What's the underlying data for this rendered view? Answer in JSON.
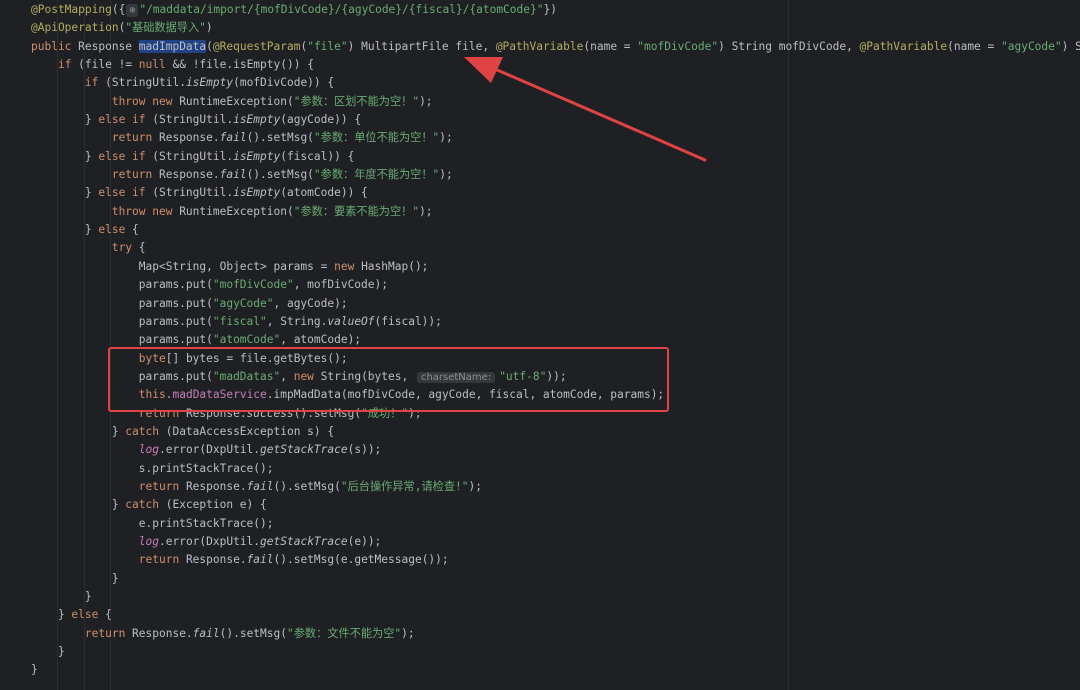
{
  "editor": {
    "language": "Java",
    "annotation_colors": {
      "highlight_box": "#e04343",
      "arrow": "#e04343",
      "selection": "#214283"
    },
    "lines": [
      [
        [
          "ann",
          "@PostMapping"
        ],
        [
          "plain",
          "({"
        ],
        [
          "fold",
          "⊕"
        ],
        [
          "str",
          "\"/maddata/import/{mofDivCode}/{agyCode}/{fiscal}/{atomCode}\""
        ],
        [
          "plain",
          "})"
        ]
      ],
      [
        [
          "ann",
          "@ApiOperation"
        ],
        [
          "plain",
          "("
        ],
        [
          "str",
          "\"基础数据导入\""
        ],
        [
          "plain",
          ")"
        ]
      ],
      [
        [
          "kw",
          "public "
        ],
        [
          "plain",
          "Response "
        ],
        [
          "sel",
          "madImpData"
        ],
        [
          "plain",
          "("
        ],
        [
          "ann",
          "@RequestParam"
        ],
        [
          "plain",
          "("
        ],
        [
          "str",
          "\"file\""
        ],
        [
          "plain",
          ") MultipartFile file, "
        ],
        [
          "ann",
          "@PathVariable"
        ],
        [
          "plain",
          "(name = "
        ],
        [
          "str",
          "\"mofDivCode\""
        ],
        [
          "plain",
          ") String mofDivCode, "
        ],
        [
          "ann",
          "@PathVariable"
        ],
        [
          "plain",
          "(name = "
        ],
        [
          "str",
          "\"agyCode\""
        ],
        [
          "plain",
          ") String"
        ]
      ],
      [
        [
          "plain",
          "    "
        ],
        [
          "kw",
          "if "
        ],
        [
          "plain",
          "(file != "
        ],
        [
          "kw",
          "null "
        ],
        [
          "plain",
          "&& !file.isEmpty()) {"
        ]
      ],
      [
        [
          "plain",
          "        "
        ],
        [
          "kw",
          "if "
        ],
        [
          "plain",
          "(StringUtil."
        ],
        [
          "static",
          "isEmpty"
        ],
        [
          "plain",
          "(mofDivCode)) {"
        ]
      ],
      [
        [
          "plain",
          "            "
        ],
        [
          "kw",
          "throw new "
        ],
        [
          "plain",
          "RuntimeException("
        ],
        [
          "str",
          "\"参数：区划不能为空！\""
        ],
        [
          "plain",
          ");"
        ]
      ],
      [
        [
          "plain",
          "        } "
        ],
        [
          "kw",
          "else if "
        ],
        [
          "plain",
          "(StringUtil."
        ],
        [
          "static",
          "isEmpty"
        ],
        [
          "plain",
          "(agyCode)) {"
        ]
      ],
      [
        [
          "plain",
          "            "
        ],
        [
          "kw",
          "return "
        ],
        [
          "plain",
          "Response."
        ],
        [
          "static",
          "fail"
        ],
        [
          "plain",
          "().setMsg("
        ],
        [
          "str",
          "\"参数：单位不能为空！\""
        ],
        [
          "plain",
          ");"
        ]
      ],
      [
        [
          "plain",
          "        } "
        ],
        [
          "kw",
          "else if "
        ],
        [
          "plain",
          "(StringUtil."
        ],
        [
          "static",
          "isEmpty"
        ],
        [
          "plain",
          "(fiscal)) {"
        ]
      ],
      [
        [
          "plain",
          "            "
        ],
        [
          "kw",
          "return "
        ],
        [
          "plain",
          "Response."
        ],
        [
          "static",
          "fail"
        ],
        [
          "plain",
          "().setMsg("
        ],
        [
          "str",
          "\"参数：年度不能为空！\""
        ],
        [
          "plain",
          ");"
        ]
      ],
      [
        [
          "plain",
          "        } "
        ],
        [
          "kw",
          "else if "
        ],
        [
          "plain",
          "(StringUtil."
        ],
        [
          "static",
          "isEmpty"
        ],
        [
          "plain",
          "(atomCode)) {"
        ]
      ],
      [
        [
          "plain",
          "            "
        ],
        [
          "kw",
          "throw new "
        ],
        [
          "plain",
          "RuntimeException("
        ],
        [
          "str",
          "\"参数：要素不能为空！\""
        ],
        [
          "plain",
          ");"
        ]
      ],
      [
        [
          "plain",
          "        } "
        ],
        [
          "kw",
          "else "
        ],
        [
          "plain",
          "{"
        ]
      ],
      [
        [
          "plain",
          "            "
        ],
        [
          "kw",
          "try "
        ],
        [
          "plain",
          "{"
        ]
      ],
      [
        [
          "plain",
          "                Map<String, Object> params = "
        ],
        [
          "kw",
          "new "
        ],
        [
          "plain",
          "HashMap();"
        ]
      ],
      [
        [
          "plain",
          "                params.put("
        ],
        [
          "str",
          "\"mofDivCode\""
        ],
        [
          "plain",
          ", mofDivCode);"
        ]
      ],
      [
        [
          "plain",
          "                params.put("
        ],
        [
          "str",
          "\"agyCode\""
        ],
        [
          "plain",
          ", agyCode);"
        ]
      ],
      [
        [
          "plain",
          "                params.put("
        ],
        [
          "str",
          "\"fiscal\""
        ],
        [
          "plain",
          ", String."
        ],
        [
          "static",
          "valueOf"
        ],
        [
          "plain",
          "(fiscal));"
        ]
      ],
      [
        [
          "plain",
          "                params.put("
        ],
        [
          "str",
          "\"atomCode\""
        ],
        [
          "plain",
          ", atomCode);"
        ]
      ],
      [
        [
          "plain",
          "                "
        ],
        [
          "kw",
          "byte"
        ],
        [
          "plain",
          "[] bytes = file.getBytes();"
        ]
      ],
      [
        [
          "plain",
          "                params.put("
        ],
        [
          "str",
          "\"madDatas\""
        ],
        [
          "plain",
          ", "
        ],
        [
          "kw",
          "new "
        ],
        [
          "plain",
          "String(bytes, "
        ],
        [
          "hint",
          "charsetName:"
        ],
        [
          "str",
          "\"utf-8\""
        ],
        [
          "plain",
          "));"
        ]
      ],
      [
        [
          "plain",
          "                "
        ],
        [
          "kw",
          "this"
        ],
        [
          "plain",
          "."
        ],
        [
          "field",
          "madDataService"
        ],
        [
          "plain",
          ".impMadData(mofDivCode, agyCode, fiscal, atomCode, params);"
        ]
      ],
      [
        [
          "plain",
          "                "
        ],
        [
          "kw",
          "return "
        ],
        [
          "plain",
          "Response."
        ],
        [
          "static",
          "success"
        ],
        [
          "plain",
          "().setMsg("
        ],
        [
          "str",
          "\"成功！\""
        ],
        [
          "plain",
          ");"
        ]
      ],
      [
        [
          "plain",
          "            } "
        ],
        [
          "kw",
          "catch "
        ],
        [
          "plain",
          "(DataAccessException s) {"
        ]
      ],
      [
        [
          "plain",
          "                "
        ],
        [
          "fieldi",
          "log"
        ],
        [
          "plain",
          ".error(DxpUtil."
        ],
        [
          "static",
          "getStackTrace"
        ],
        [
          "plain",
          "(s));"
        ]
      ],
      [
        [
          "plain",
          "                s.printStackTrace();"
        ]
      ],
      [
        [
          "plain",
          "                "
        ],
        [
          "kw",
          "return "
        ],
        [
          "plain",
          "Response."
        ],
        [
          "static",
          "fail"
        ],
        [
          "plain",
          "().setMsg("
        ],
        [
          "str",
          "\"后台操作异常,请检查!\""
        ],
        [
          "plain",
          ");"
        ]
      ],
      [
        [
          "plain",
          "            } "
        ],
        [
          "kw",
          "catch "
        ],
        [
          "plain",
          "(Exception e) {"
        ]
      ],
      [
        [
          "plain",
          "                e.printStackTrace();"
        ]
      ],
      [
        [
          "plain",
          "                "
        ],
        [
          "fieldi",
          "log"
        ],
        [
          "plain",
          ".error(DxpUtil."
        ],
        [
          "static",
          "getStackTrace"
        ],
        [
          "plain",
          "(e));"
        ]
      ],
      [
        [
          "plain",
          "                "
        ],
        [
          "kw",
          "return "
        ],
        [
          "plain",
          "Response."
        ],
        [
          "static",
          "fail"
        ],
        [
          "plain",
          "().setMsg(e.getMessage());"
        ]
      ],
      [
        [
          "plain",
          "            }"
        ]
      ],
      [
        [
          "plain",
          "        }"
        ]
      ],
      [
        [
          "plain",
          "    } "
        ],
        [
          "kw",
          "else "
        ],
        [
          "plain",
          "{"
        ]
      ],
      [
        [
          "plain",
          "        "
        ],
        [
          "kw",
          "return "
        ],
        [
          "plain",
          "Response."
        ],
        [
          "static",
          "fail"
        ],
        [
          "plain",
          "().setMsg("
        ],
        [
          "str",
          "\"参数：文件不能为空\""
        ],
        [
          "plain",
          ");"
        ]
      ],
      [
        [
          "plain",
          "    }"
        ]
      ],
      [
        [
          "plain",
          "}"
        ]
      ]
    ]
  }
}
